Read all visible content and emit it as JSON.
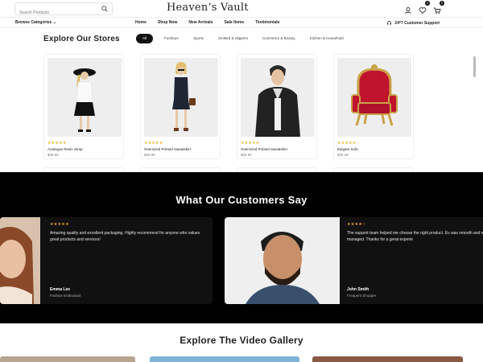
{
  "header": {
    "search_placeholder": "Search Products",
    "logo": "Heaven’s Vault",
    "wishlist_count": "0",
    "cart_count": "0",
    "browse_label": "Browse Categories",
    "nav": [
      "Home",
      "Shop Now",
      "New Arrivals",
      "Sale Items",
      "Testimonials"
    ],
    "support": "24*7 Customer Support"
  },
  "stores": {
    "title": "Explore Our Stores",
    "tabs": [
      "All",
      "Furniture",
      "Sports",
      "Smitted & Slippers",
      "Cosmetics & Beauty",
      "Kitchen & Household"
    ],
    "active_tab": "All",
    "products": [
      {
        "name": "Analogue Resin Strap",
        "price": "$30.00",
        "stars": "★★★★★"
      },
      {
        "name": "Oversized Printed Sweatshirt",
        "price": "$30.00",
        "stars": "★★★★★"
      },
      {
        "name": "Oversized Printed Sweatshirt",
        "price": "$30.00",
        "stars": "★★★★★"
      },
      {
        "name": "Elegant Sofa",
        "price": "$35.00",
        "stars": "★★★★★"
      }
    ]
  },
  "testimonials": {
    "title": "What Our Customers Say",
    "items": [
      {
        "stars": "★★★★★",
        "quote": "Amazing quality and excellent packaging. Highly recommend for anyone who values great products and services!",
        "author": "Emma Lee",
        "role": "Fashion Enthusiast"
      },
      {
        "stars": "★★★★☆",
        "quote": "The support team helped me choose the right product. Ev was smooth and well-managed. Thanks for a great experie",
        "author": "John Smith",
        "role": "Frequent Shopper"
      }
    ]
  },
  "video": {
    "title": "Explore The Video Gallery"
  },
  "colors": {
    "accent": "#111111",
    "star": "#f2b01e",
    "sofa": "#c0142c",
    "dark_bg": "#000000"
  }
}
